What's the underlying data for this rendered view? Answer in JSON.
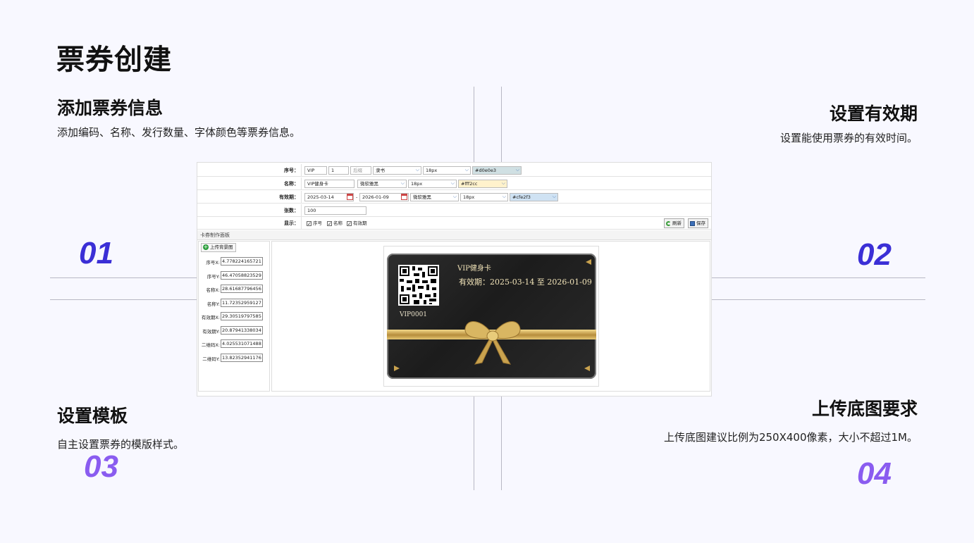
{
  "page": {
    "title": "票券创建"
  },
  "sections": [
    {
      "number": "01",
      "title": "添加票券信息",
      "desc": "添加编码、名称、发行数量、字体颜色等票券信息。"
    },
    {
      "number": "02",
      "title": "设置有效期",
      "desc": "设置能使用票券的有效时间。"
    },
    {
      "number": "03",
      "title": "设置模板",
      "desc": "自主设置票券的模版样式。"
    },
    {
      "number": "04",
      "title": "上传底图要求",
      "desc": "上传底图建议比例为250X400像素，大小不超过1M。"
    }
  ],
  "colors": {
    "num_01_02": "#3b2fd6",
    "num_03_04": "#8a5cf0"
  },
  "form": {
    "serial": {
      "label": "序号：",
      "prefix": "VIP",
      "start": "1",
      "suffix_placeholder": "后缀",
      "font": "隶书",
      "size": "18px",
      "color": "#d0e0e3"
    },
    "name": {
      "label": "名称：",
      "value": "VIP健身卡",
      "font": "微软雅黑",
      "size": "18px",
      "color": "#fff2cc"
    },
    "validity": {
      "label": "有效期：",
      "start": "2025-03-14",
      "separator": "-",
      "end": "2026-01-09",
      "font": "微软雅黑",
      "size": "18px",
      "color": "#cfe2f3"
    },
    "count": {
      "label": "张数：",
      "value": "100"
    },
    "display": {
      "label": "显示：",
      "options": [
        "序号",
        "名称",
        "有效期"
      ]
    },
    "refresh_label": "刷新",
    "save_label": "保存"
  },
  "panel": {
    "title": "卡券制作面板",
    "upload_label": "上传背景图",
    "coords": [
      {
        "label": "序号X:",
        "value": "4.778224165721"
      },
      {
        "label": "序号Y:",
        "value": "46.47058823529"
      },
      {
        "label": "名称X:",
        "value": "28.61687796456"
      },
      {
        "label": "名称Y:",
        "value": "11.72352959127"
      },
      {
        "label": "有效期X:",
        "value": "29.30519797585"
      },
      {
        "label": "有效期Y:",
        "value": "20.87941338034"
      },
      {
        "label": "二维码X:",
        "value": "4.025531071488"
      },
      {
        "label": "二维码Y:",
        "value": "13.82352941176"
      }
    ]
  },
  "card": {
    "name": "VIP健身卡",
    "validity": "有效期：2025-03-14 至 2026-01-09",
    "serial": "VIP0001"
  }
}
